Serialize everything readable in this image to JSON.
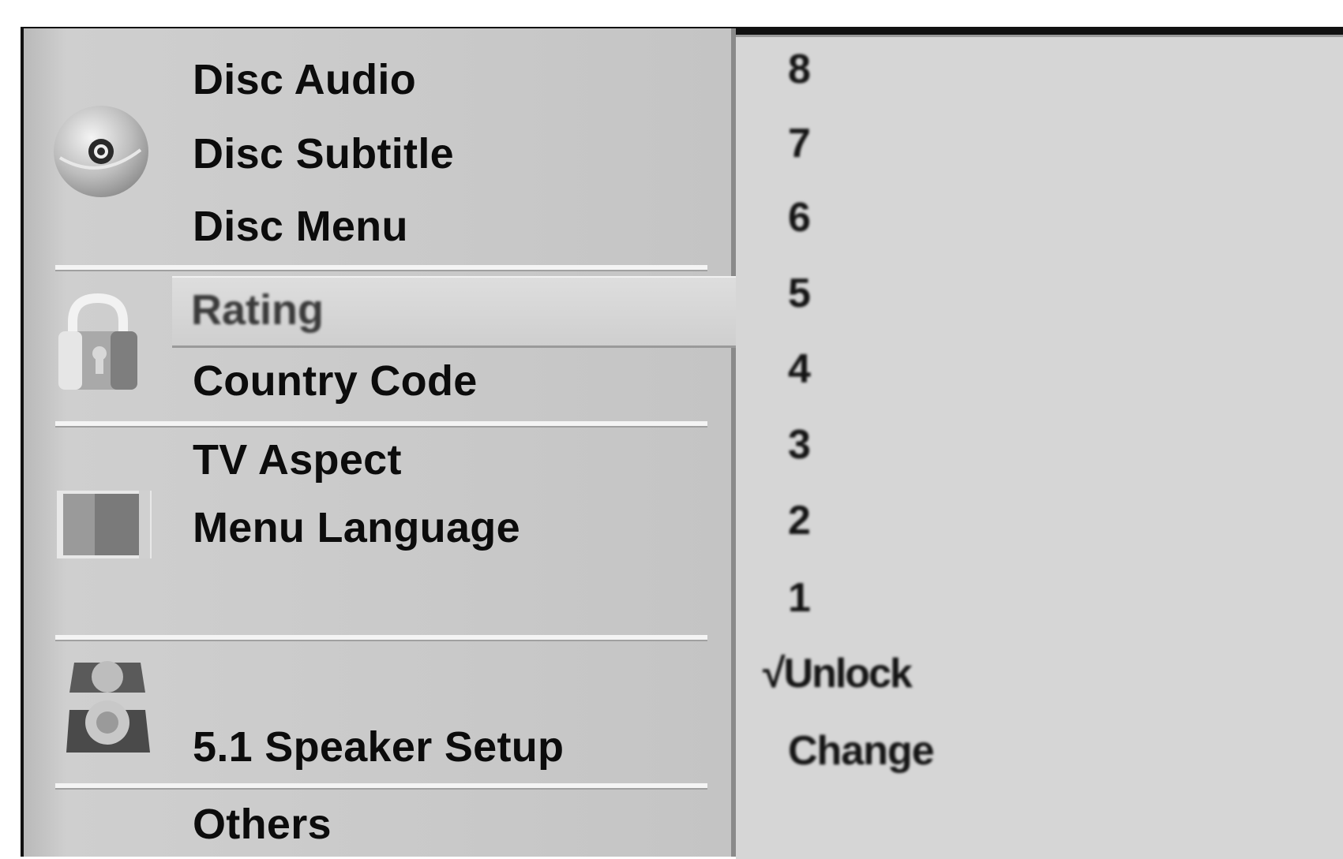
{
  "menu": {
    "disc_section": [
      "Disc Audio",
      "Disc Subtitle",
      "Disc Menu"
    ],
    "lock_section": [
      "Rating",
      "Country Code"
    ],
    "display_section": [
      "TV Aspect",
      "Menu Language"
    ],
    "audio_section": [
      "5.1 Speaker Setup"
    ],
    "others_section": [
      "Others"
    ],
    "selected": "Rating"
  },
  "rating_options": [
    "8",
    "7",
    "6",
    "5",
    "4",
    "3",
    "2",
    "1",
    "√Unlock",
    "Change"
  ],
  "icons": {
    "disc": "disc-icon",
    "lock": "padlock-icon",
    "tv": "tv-icon",
    "speaker": "speaker-icon"
  },
  "colors": {
    "menu_bg": "#c9c9c9",
    "option_bg": "#d6d6d6",
    "highlight": "#d9d9d9"
  }
}
